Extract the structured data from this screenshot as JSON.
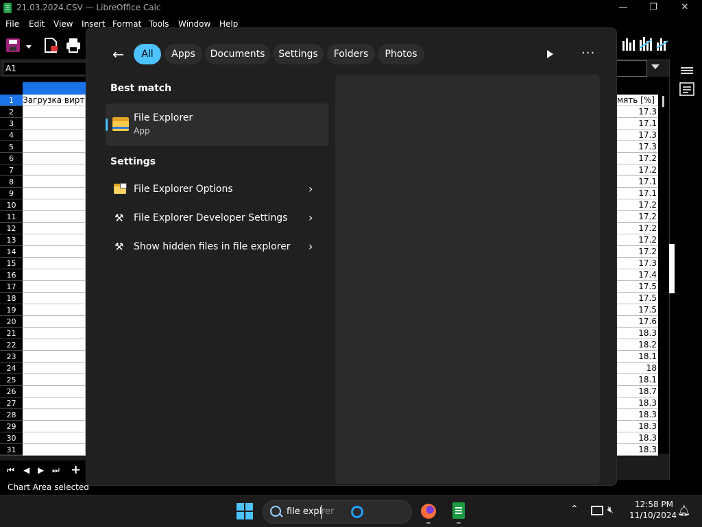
{
  "window": {
    "title": "21.03.2024.CSV — LibreOffice Calc",
    "minimize": "—",
    "maximize": "❐",
    "close": "✕"
  },
  "menu": [
    "File",
    "Edit",
    "View",
    "Insert",
    "Format",
    "Tools",
    "Window",
    "Help"
  ],
  "name_box": "A1",
  "sheet": {
    "row_numbers": [
      "1",
      "2",
      "3",
      "4",
      "5",
      "6",
      "7",
      "8",
      "9",
      "10",
      "11",
      "12",
      "13",
      "14",
      "15",
      "16",
      "17",
      "18",
      "19",
      "20",
      "21",
      "22",
      "23",
      "24",
      "25",
      "26",
      "27",
      "28",
      "29",
      "30",
      "31"
    ],
    "cell_a1": "Загрузка вирту",
    "right_col_header": "мять [%]",
    "right_col_values": [
      "17.3",
      "17.1",
      "17.3",
      "17.3",
      "17.2",
      "17.2",
      "17.1",
      "17.1",
      "17.2",
      "17.2",
      "17.2",
      "17.2",
      "17.2",
      "17.3",
      "17.4",
      "17.5",
      "17.5",
      "17.5",
      "17.6",
      "18.3",
      "18.2",
      "18.1",
      "18",
      "18.1",
      "18.7",
      "18.3",
      "18.3",
      "18.3",
      "18.3",
      "18.3"
    ]
  },
  "status": {
    "text": "Chart Area selected"
  },
  "search_panel": {
    "filters": [
      "All",
      "Apps",
      "Documents",
      "Settings",
      "Folders",
      "Photos"
    ],
    "active_filter": "All",
    "best_match_heading": "Best match",
    "best_match": {
      "title": "File Explorer",
      "subtitle": "App"
    },
    "settings_heading": "Settings",
    "settings_items": [
      {
        "label": "File Explorer Options"
      },
      {
        "label": "File Explorer Developer Settings"
      },
      {
        "label": "Show hidden files in file explorer"
      }
    ],
    "accent_color": "#4cc2ff"
  },
  "taskbar": {
    "search_typed": "file expl",
    "search_hint": "rer",
    "time": "12:58 PM",
    "date": "11/10/2024"
  }
}
